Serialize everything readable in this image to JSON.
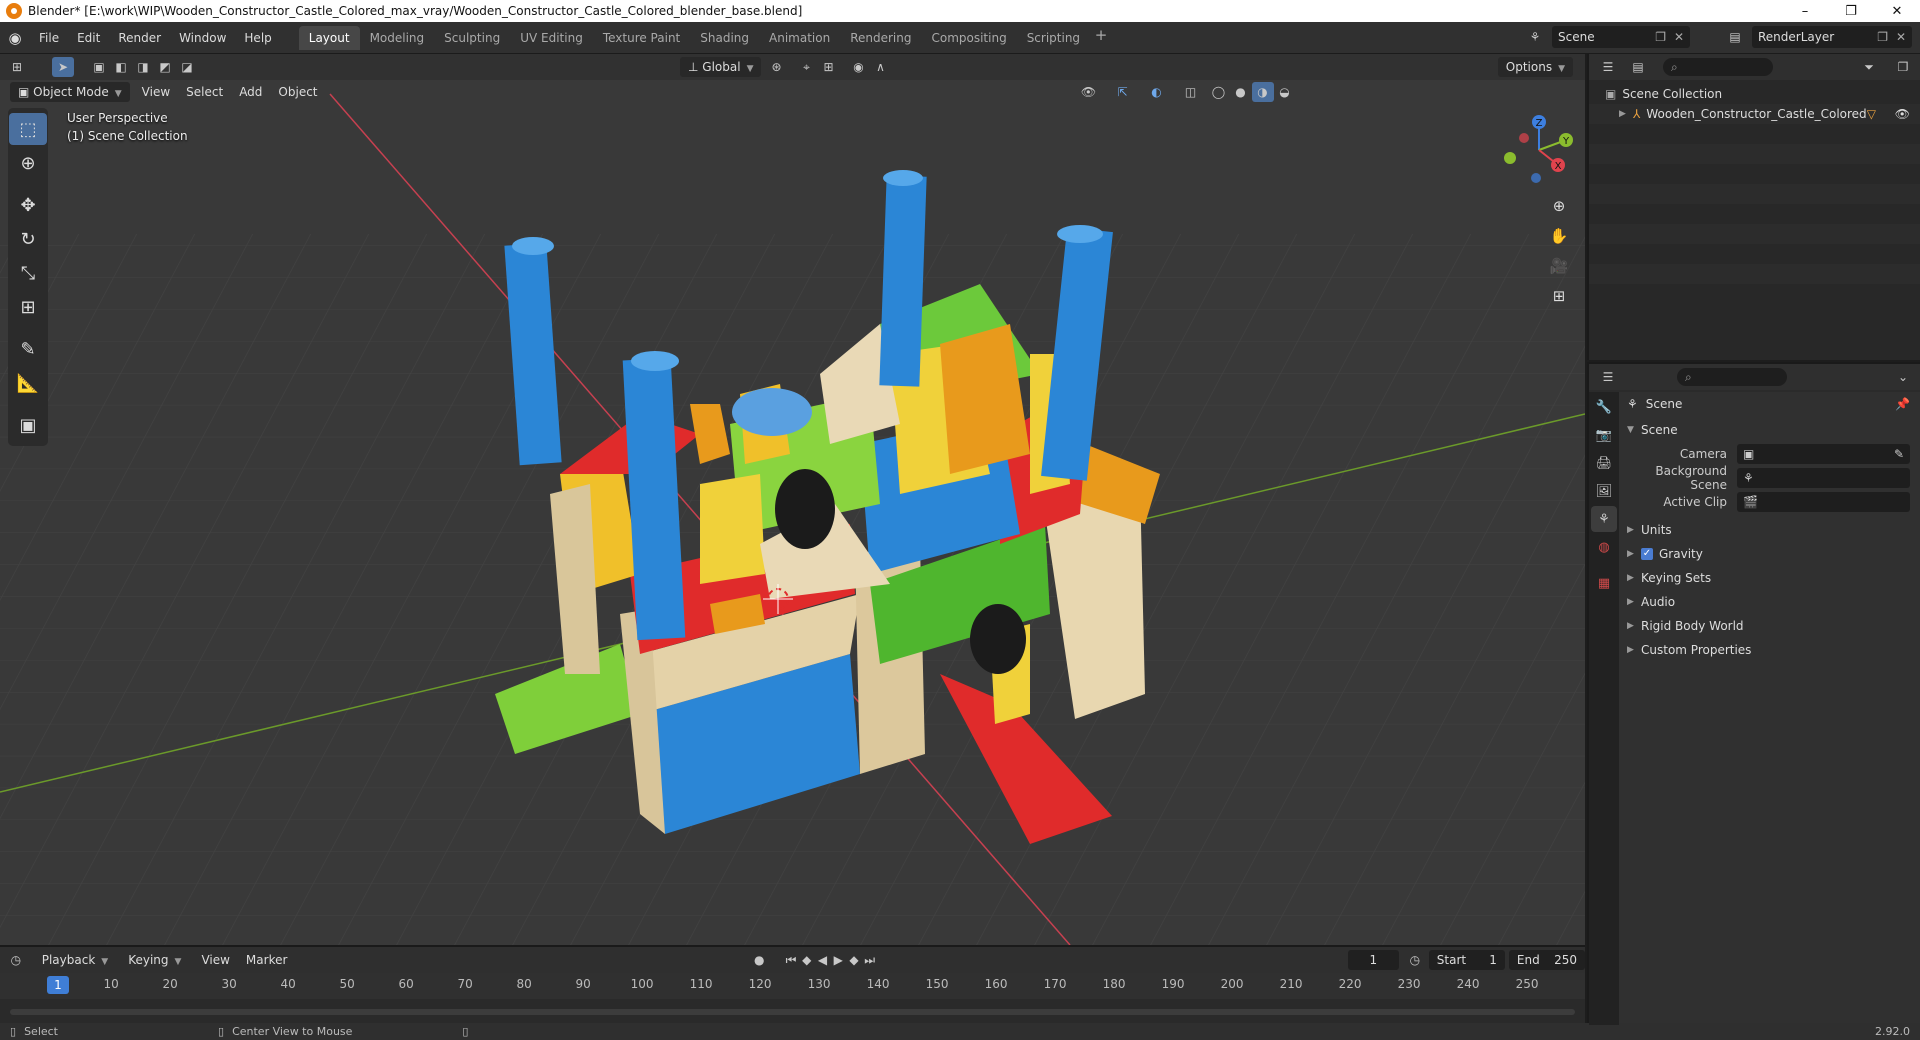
{
  "window": {
    "title": "Blender* [E:\\work\\WIP\\Wooden_Constructor_Castle_Colored_max_vray/Wooden_Constructor_Castle_Colored_blender_base.blend]",
    "min": "–",
    "max": "❐",
    "close": "✕"
  },
  "menu": {
    "file": "File",
    "edit": "Edit",
    "render": "Render",
    "window": "Window",
    "help": "Help"
  },
  "workspaces": [
    "Layout",
    "Modeling",
    "Sculpting",
    "UV Editing",
    "Texture Paint",
    "Shading",
    "Animation",
    "Rendering",
    "Compositing",
    "Scripting"
  ],
  "scene_name": "Scene",
  "render_layer": "RenderLayer",
  "viewport": {
    "orientation": "Global",
    "options": "Options",
    "mode": "Object Mode",
    "menus": {
      "view": "View",
      "select": "Select",
      "add": "Add",
      "object": "Object"
    },
    "perspective": "User Perspective",
    "collection_label": "(1) Scene Collection",
    "gizmo": {
      "x": "X",
      "y": "Y",
      "z": "Z"
    }
  },
  "timeline": {
    "menus": {
      "playback": "Playback",
      "keying": "Keying",
      "view": "View",
      "marker": "Marker"
    },
    "current_frame": "1",
    "start_label": "Start",
    "start": "1",
    "end_label": "End",
    "end": "250",
    "ticks": [
      "10",
      "20",
      "30",
      "40",
      "50",
      "60",
      "70",
      "80",
      "90",
      "100",
      "110",
      "120",
      "130",
      "140",
      "150",
      "160",
      "170",
      "180",
      "190",
      "200",
      "210",
      "220",
      "230",
      "240",
      "250"
    ],
    "ruler_frame": "1"
  },
  "outliner": {
    "root": "Scene Collection",
    "item": "Wooden_Constructor_Castle_Colored"
  },
  "properties": {
    "context": "Scene",
    "section": "Scene",
    "camera_label": "Camera",
    "background_label": "Background Scene",
    "clip_label": "Active Clip",
    "panels": {
      "units": "Units",
      "gravity": "Gravity",
      "keying": "Keying Sets",
      "audio": "Audio",
      "rigid": "Rigid Body World",
      "custom": "Custom Properties"
    }
  },
  "status": {
    "select": "Select",
    "center": "Center View to Mouse",
    "version": "2.92.0"
  },
  "colors": {
    "accent": "#4a7cd1",
    "active_frame": "#3f7ed6",
    "x_axis": "#e0434d",
    "y_axis": "#8bbc2e",
    "z_axis": "#3d7fe0"
  }
}
